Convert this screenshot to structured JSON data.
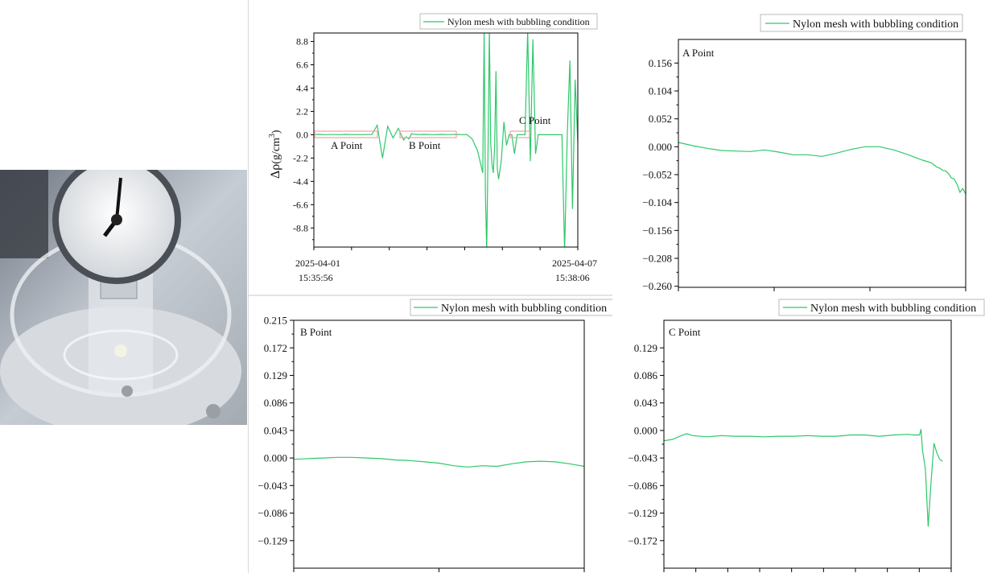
{
  "theme": {
    "line_color": "#2ec86b",
    "axis_color": "#000000",
    "highlight_color": "#f3a0a0"
  },
  "photo": {
    "description_icon": "pressure-gauge-photo-icon"
  },
  "chart_data": [
    {
      "id": "overview",
      "type": "line",
      "legend": "Nylon mesh with bubbling condition",
      "ylabel_main": "Δρ",
      "ylabel_unit": "(g/cm",
      "ylabel_sup": "3",
      "ylabel_close": ")",
      "ylim": [
        -10.6,
        9.6
      ],
      "yticks": [
        "8.8",
        "6.6",
        "4.4",
        "2.2",
        "0.0",
        "-2.2",
        "-4.4",
        "-6.6",
        "-8.8"
      ],
      "ytick_values": [
        8.8,
        6.6,
        4.4,
        2.2,
        0.0,
        -2.2,
        -4.4,
        -6.6,
        -8.8
      ],
      "xtick_start": [
        "2025-04-01",
        "15:35:56"
      ],
      "xtick_end": [
        "2025-04-07",
        "15:38:06"
      ],
      "annotations": [
        "A Point",
        "B Point",
        "C Point"
      ],
      "x": [
        0,
        2,
        4,
        6,
        8,
        10,
        12,
        14,
        16,
        18,
        20,
        22,
        24,
        26,
        28,
        30,
        32,
        34,
        35,
        36,
        37,
        38,
        39,
        40,
        42,
        44,
        46,
        48,
        50,
        52,
        54,
        56,
        58,
        60,
        62,
        64,
        64.5,
        65,
        65.5,
        66,
        66.5,
        67,
        67.5,
        68,
        68.5,
        69,
        69.5,
        70,
        71,
        72,
        73,
        74,
        75,
        76,
        77,
        78,
        79,
        80,
        81,
        82,
        83,
        84,
        85,
        86,
        87,
        88,
        89,
        90,
        91,
        92,
        93,
        94,
        95,
        96,
        97,
        98,
        99,
        100
      ],
      "y": [
        0.02,
        0.03,
        0.01,
        0.02,
        0.02,
        0.01,
        0.03,
        0.02,
        0.02,
        0.01,
        0.02,
        0.03,
        0.9,
        -2.2,
        0.8,
        -0.3,
        0.6,
        -0.5,
        -0.2,
        -0.4,
        0.1,
        0.05,
        0.03,
        0.02,
        0.03,
        0.02,
        0.01,
        0.03,
        0.02,
        0.02,
        0.03,
        0.01,
        0.02,
        -0.4,
        -1.5,
        -3.6,
        9.8,
        -5.6,
        -11.0,
        -1.2,
        9.8,
        -0.8,
        -2.8,
        -3.6,
        -1.0,
        6.0,
        -3.2,
        -4.2,
        -2.5,
        1.2,
        -1.0,
        0.0,
        0.0,
        -1.8,
        0.0,
        0.0,
        0.0,
        0.0,
        9.8,
        -2.5,
        9.0,
        -1.8,
        0.0,
        0.0,
        0.0,
        0.0,
        0.0,
        0.0,
        0.0,
        0.0,
        0.0,
        0.0,
        -11.0,
        0.0,
        7.0,
        -7.0,
        5.2,
        -0.8
      ]
    },
    {
      "id": "a-point",
      "type": "line",
      "legend": "Nylon mesh with bubbling condition",
      "label": "A Point",
      "ylim": [
        -0.262,
        0.2
      ],
      "yticks": [
        "0.156",
        "0.104",
        "0.052",
        "0.000",
        "−0.052",
        "−0.104",
        "−0.156",
        "−0.208",
        "−0.260"
      ],
      "ytick_values": [
        0.156,
        0.104,
        0.052,
        0.0,
        -0.052,
        -0.104,
        -0.156,
        -0.208,
        -0.26
      ],
      "x": [
        0,
        5,
        10,
        15,
        20,
        25,
        30,
        35,
        40,
        45,
        50,
        55,
        60,
        65,
        70,
        75,
        80,
        85,
        88,
        90,
        91,
        92,
        93,
        94,
        95,
        96,
        97,
        98,
        99,
        100
      ],
      "y": [
        0.008,
        0.002,
        -0.003,
        -0.007,
        -0.008,
        -0.009,
        -0.006,
        -0.01,
        -0.015,
        -0.015,
        -0.018,
        -0.012,
        -0.005,
        0.0,
        0.0,
        -0.006,
        -0.015,
        -0.025,
        -0.03,
        -0.038,
        -0.04,
        -0.044,
        -0.045,
        -0.05,
        -0.058,
        -0.06,
        -0.07,
        -0.085,
        -0.078,
        -0.088
      ]
    },
    {
      "id": "b-point",
      "type": "line",
      "legend": "Nylon mesh with bubbling condition",
      "label": "B Point",
      "ylim": [
        -0.172,
        0.215
      ],
      "yticks": [
        "0.215",
        "0.172",
        "0.129",
        "0.086",
        "0.043",
        "0.000",
        "−0.043",
        "−0.086",
        "−0.129"
      ],
      "ytick_values": [
        0.215,
        0.172,
        0.129,
        0.086,
        0.043,
        0.0,
        -0.043,
        -0.086,
        -0.129
      ],
      "x": [
        0,
        5,
        10,
        15,
        20,
        25,
        30,
        35,
        40,
        45,
        50,
        55,
        60,
        65,
        70,
        75,
        80,
        85,
        90,
        95,
        100
      ],
      "y": [
        -0.002,
        -0.001,
        0.0,
        0.001,
        0.001,
        0.0,
        -0.001,
        -0.003,
        -0.004,
        -0.006,
        -0.008,
        -0.012,
        -0.014,
        -0.012,
        -0.013,
        -0.009,
        -0.006,
        -0.005,
        -0.006,
        -0.009,
        -0.013
      ]
    },
    {
      "id": "c-point",
      "type": "line",
      "legend": "Nylon mesh with bubbling condition",
      "label": "C Point",
      "ylim": [
        -0.215,
        0.172
      ],
      "yticks": [
        "0.129",
        "0.086",
        "0.043",
        "0.000",
        "−0.043",
        "−0.086",
        "−0.129",
        "−0.172"
      ],
      "ytick_values": [
        0.129,
        0.086,
        0.043,
        0.0,
        -0.043,
        -0.086,
        -0.129,
        -0.172
      ],
      "x": [
        0,
        3,
        6,
        8,
        10,
        15,
        20,
        25,
        30,
        35,
        40,
        45,
        50,
        55,
        60,
        65,
        70,
        75,
        80,
        85,
        87,
        88,
        89,
        89.5,
        90,
        91,
        92,
        93,
        94,
        95,
        96,
        97
      ],
      "y": [
        -0.016,
        -0.014,
        -0.008,
        -0.005,
        -0.008,
        -0.01,
        -0.008,
        -0.009,
        -0.009,
        -0.01,
        -0.009,
        -0.009,
        -0.008,
        -0.009,
        -0.009,
        -0.007,
        -0.007,
        -0.009,
        -0.007,
        -0.006,
        -0.007,
        -0.007,
        -0.007,
        0.002,
        -0.03,
        -0.06,
        -0.15,
        -0.08,
        -0.02,
        -0.035,
        -0.045,
        -0.048
      ]
    }
  ]
}
